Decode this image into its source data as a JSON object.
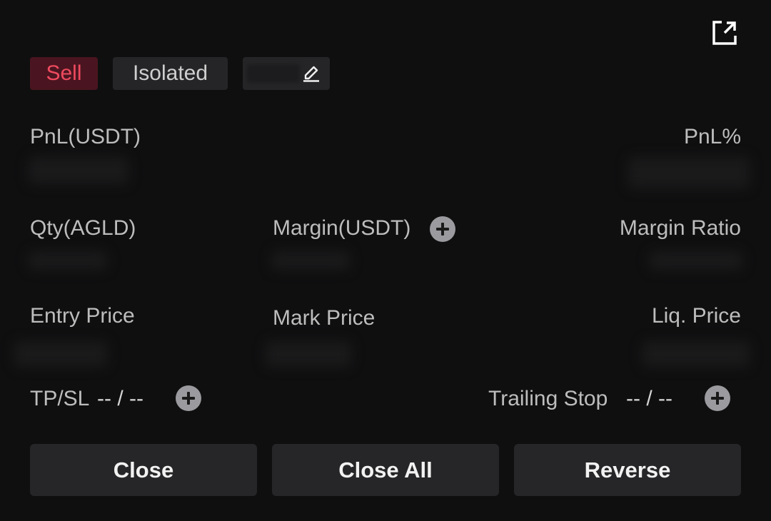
{
  "header": {
    "share_icon": "external-link-icon"
  },
  "badges": {
    "side": "Sell",
    "margin_mode": "Isolated",
    "edit_icon": "pencil-icon"
  },
  "fields": {
    "pnl_label": "PnL(USDT)",
    "pnl_pct_label": "PnL%",
    "qty_label": "Qty(AGLD)",
    "margin_label": "Margin(USDT)",
    "margin_ratio_label": "Margin Ratio",
    "entry_price_label": "Entry Price",
    "mark_price_label": "Mark Price",
    "liq_price_label": "Liq. Price"
  },
  "tpsl": {
    "label": "TP/SL",
    "value": "-- / --"
  },
  "trailing": {
    "label": "Trailing Stop",
    "value": "-- / --"
  },
  "buttons": {
    "close": "Close",
    "close_all": "Close All",
    "reverse": "Reverse"
  },
  "colors": {
    "sell": "#ef4a5f",
    "sell_bg": "#4a1520",
    "background": "#0f0f10",
    "button_bg": "#262628"
  }
}
